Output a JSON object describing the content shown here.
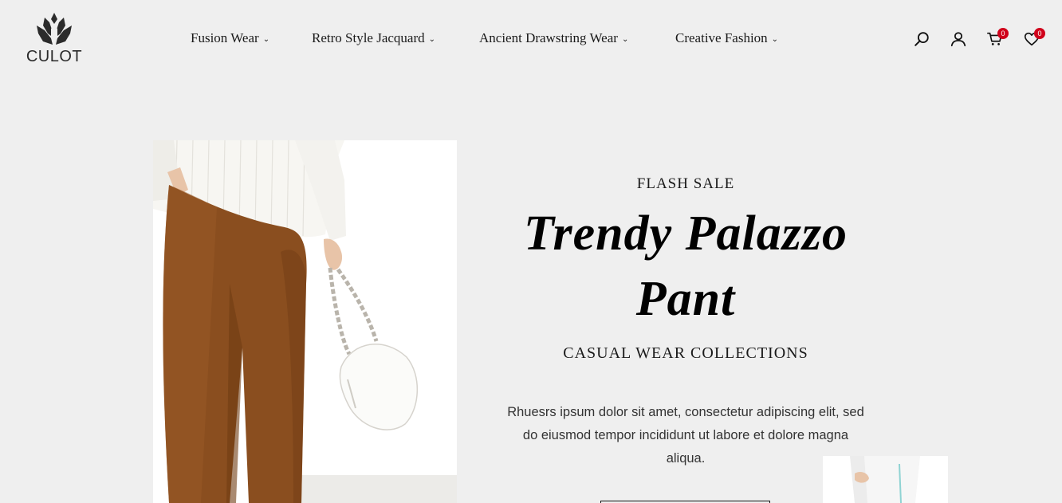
{
  "brand": {
    "name": "CULOT"
  },
  "nav": {
    "items": [
      {
        "label": "Fusion Wear",
        "chevron": "⌄"
      },
      {
        "label": "Retro Style Jacquard",
        "chevron": "⌄"
      },
      {
        "label": "Ancient Drawstring Wear",
        "chevron": "⌄"
      },
      {
        "label": "Creative Fashion",
        "chevron": "⌄"
      }
    ]
  },
  "header_icons": {
    "search": "search-icon",
    "account": "user-icon",
    "cart": {
      "icon": "cart-icon",
      "count": "0"
    },
    "wishlist": {
      "icon": "heart-icon",
      "count": "0"
    }
  },
  "hero": {
    "eyebrow": "FLASH SALE",
    "headline_line1": "Trendy Palazzo",
    "headline_line2": "Pant",
    "subhead": "CASUAL WEAR COLLECTIONS",
    "description": "Rhuesrs ipsum dolor sit amet, consectetur adipiscing elit, sed do eiusmod tempor incididunt ut labore et dolore magna aliqua."
  },
  "colors": {
    "background": "#efefef",
    "badge": "#d0021b",
    "text": "#1a1a1a",
    "pants": "#8a4e1f",
    "sweater": "#f7f6f2"
  }
}
